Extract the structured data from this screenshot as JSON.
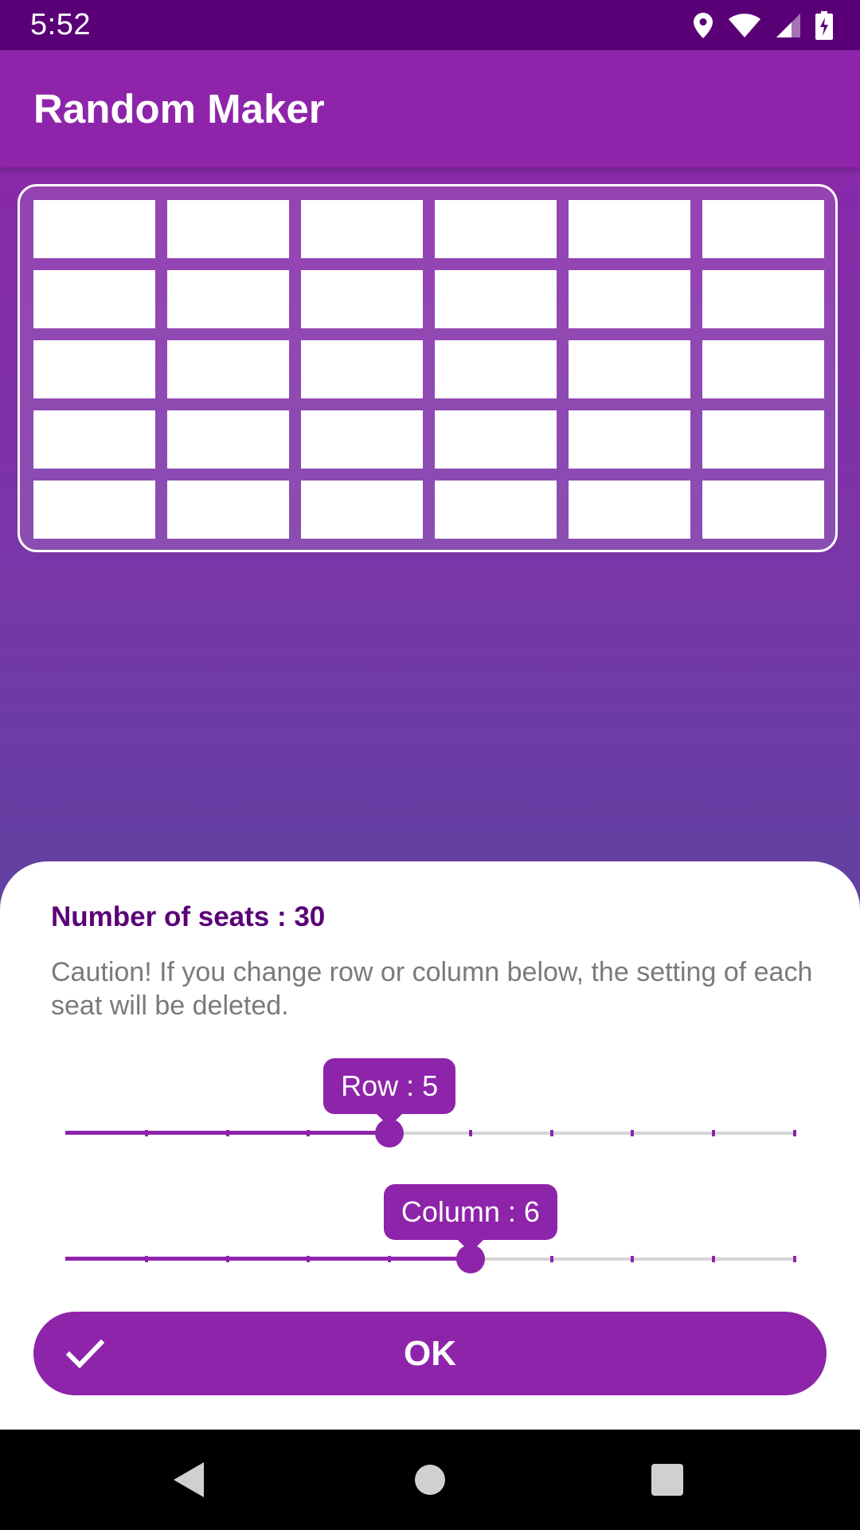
{
  "status_bar": {
    "time": "5:52",
    "icons": [
      "location-icon",
      "wifi-icon",
      "cell-signal-icon",
      "battery-charging-icon"
    ]
  },
  "app_bar": {
    "title": "Random Maker"
  },
  "seat_grid": {
    "rows": 5,
    "columns": 6
  },
  "sheet": {
    "seat_count_label": "Number of seats : 30",
    "caution_text": "Caution! If you change row or column below, the setting of each seat will be deleted.",
    "row_slider": {
      "label": "Row : 5",
      "value": 5,
      "min": 1,
      "max": 10
    },
    "column_slider": {
      "label": "Column : 6",
      "value": 6,
      "min": 1,
      "max": 10
    },
    "ok_button": {
      "label": "OK",
      "icon": "check-icon"
    }
  },
  "nav_bar": {
    "buttons": [
      "back-icon",
      "home-icon",
      "recents-icon"
    ]
  },
  "colors": {
    "primary": "#8e24aa",
    "primary_dark": "#5a0076",
    "sheet_background": "#ffffff",
    "caution_text": "#7a7a7a"
  }
}
